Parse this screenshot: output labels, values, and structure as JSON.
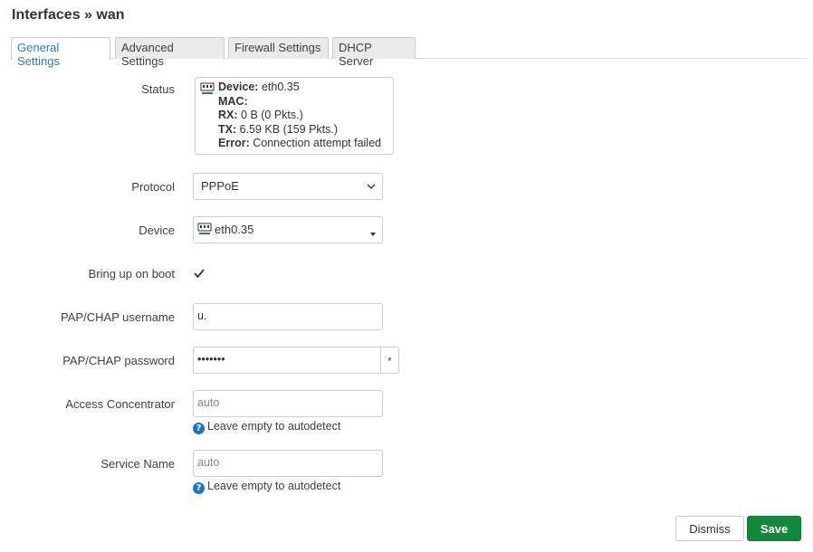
{
  "page": {
    "title": "Interfaces » wan"
  },
  "tabs": [
    {
      "label": "General Settings",
      "active": true
    },
    {
      "label": "Advanced Settings",
      "active": false
    },
    {
      "label": "Firewall Settings",
      "active": false
    },
    {
      "label": "DHCP Server",
      "active": false
    }
  ],
  "status": {
    "label": "Status",
    "icon": "ethernet-port-icon",
    "lines": [
      {
        "key": "Device:",
        "value": "eth0.35"
      },
      {
        "key": "MAC:",
        "value": ""
      },
      {
        "key": "RX:",
        "value": "0 B (0 Pkts.)"
      },
      {
        "key": "TX:",
        "value": "6.59 KB (159 Pkts.)"
      },
      {
        "key": "Error:",
        "value": "Connection attempt failed"
      }
    ]
  },
  "protocol": {
    "label": "Protocol",
    "value": "PPPoE"
  },
  "device": {
    "label": "Device",
    "value": "eth0.35",
    "icon": "ethernet-port-icon"
  },
  "boot": {
    "label": "Bring up on boot",
    "checked": true
  },
  "username": {
    "label": "PAP/CHAP username",
    "value": "u."
  },
  "password": {
    "label": "PAP/CHAP password",
    "value": "•••••••",
    "reveal_label": "*"
  },
  "concentrator": {
    "label": "Access Concentrator",
    "placeholder": "auto",
    "hint": "Leave empty to autodetect"
  },
  "service": {
    "label": "Service Name",
    "placeholder": "auto",
    "hint": "Leave empty to autodetect"
  },
  "buttons": {
    "dismiss": "Dismiss",
    "save": "Save"
  },
  "colors": {
    "accent": "#3a7bb5",
    "save": "#0f8a3b",
    "hint_icon": "#1b74c4"
  }
}
